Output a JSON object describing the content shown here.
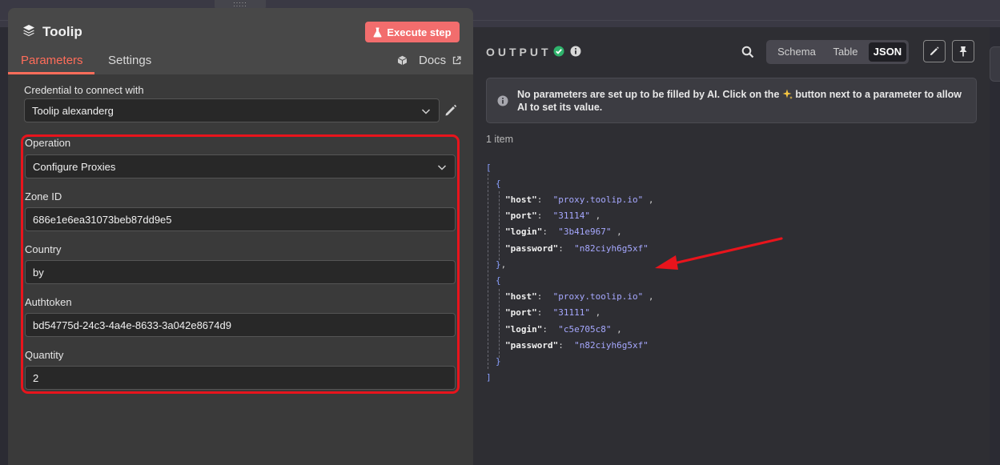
{
  "canvas": {
    "drag_handle": ":::::"
  },
  "node": {
    "title": "Toolip",
    "execute_label": "Execute step",
    "tabs": [
      {
        "label": "Parameters"
      },
      {
        "label": "Settings"
      }
    ],
    "docs_label": "Docs"
  },
  "params": {
    "credential": {
      "label": "Credential to connect with",
      "value": "Toolip alexanderg"
    },
    "operation": {
      "label": "Operation",
      "value": "Configure Proxies"
    },
    "zone_id": {
      "label": "Zone ID",
      "value": "686e1e6ea31073beb87dd9e5"
    },
    "country": {
      "label": "Country",
      "value": "by"
    },
    "authtoken": {
      "label": "Authtoken",
      "value": "bd54775d-24c3-4a4e-8633-3a042e8674d9"
    },
    "quantity": {
      "label": "Quantity",
      "value": "2"
    }
  },
  "output": {
    "title": "OUTPUT",
    "views": [
      {
        "label": "Schema"
      },
      {
        "label": "Table"
      },
      {
        "label": "JSON"
      }
    ],
    "selected_view": "JSON",
    "ai_notice_part1": "No parameters are set up to be filled by AI. Click on the ",
    "ai_notice_part2": " button next to a parameter to allow AI to set its value.",
    "item_count": "1 item",
    "json_items": [
      {
        "host": "proxy.toolip.io",
        "port": "31114",
        "login": "3b41e967",
        "password": "n82ciyh6g5xf"
      },
      {
        "host": "proxy.toolip.io",
        "port": "31111",
        "login": "c5e705c8",
        "password": "n82ciyh6g5xf"
      }
    ]
  },
  "colors": {
    "accent": "#ff6d5a",
    "execute_button": "#f26d6d",
    "highlight_border": "#e8141c",
    "success": "#2fb36c",
    "json_value": "#a6a8ff"
  },
  "icons": {
    "node": "layers-icon",
    "execute": "flask-icon",
    "docs": "cube-icon",
    "external": "external-link-icon",
    "edit": "pencil-icon",
    "chevron": "chevron-down-icon",
    "status": "check-circle-icon",
    "info": "info-icon",
    "search": "search-icon",
    "pin": "pin-icon",
    "sparkle": "sparkles-icon"
  }
}
